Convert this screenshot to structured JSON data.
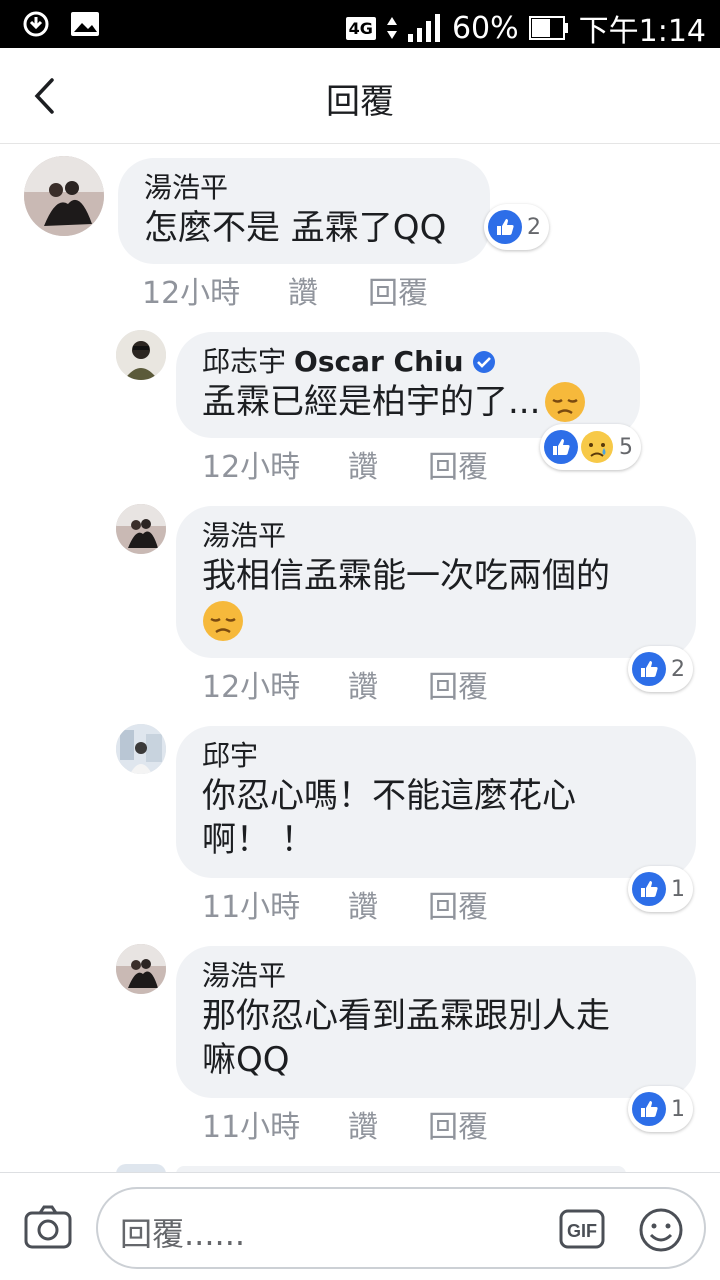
{
  "status_bar": {
    "network": "4G",
    "battery": "60%",
    "time": "下午1:14"
  },
  "header": {
    "title": "回覆"
  },
  "actions": {
    "like": "讚",
    "reply": "回覆"
  },
  "comments": [
    {
      "author": "湯浩平",
      "text": "怎麼不是 孟霖了QQ",
      "time": "12小時",
      "reactions": "2"
    },
    {
      "author": "邱志宇",
      "author_latin": "Oscar Chiu",
      "verified": true,
      "text": "孟霖已經是柏宇的了...",
      "time": "12小時",
      "reactions": "5"
    },
    {
      "author": "湯浩平",
      "text": "我相信孟霖能一次吃兩個的",
      "time": "12小時",
      "reactions": "2"
    },
    {
      "author": "邱宇",
      "text_line1": "你忍心嗎！不能這麼花心",
      "text_line2": "啊！ ！",
      "time": "11小時",
      "reactions": "1"
    },
    {
      "author": "湯浩平",
      "text_line1": "那你忍心看到孟霖跟別人走",
      "text_line2": "嘛QQ",
      "time": "11小時",
      "reactions": "1"
    }
  ],
  "composer": {
    "placeholder": "回覆......",
    "gif_label": "GIF"
  },
  "colors": {
    "like_blue": "#2d6ee8",
    "bubble_bg": "#f0f2f5",
    "meta_gray": "#90949c"
  }
}
